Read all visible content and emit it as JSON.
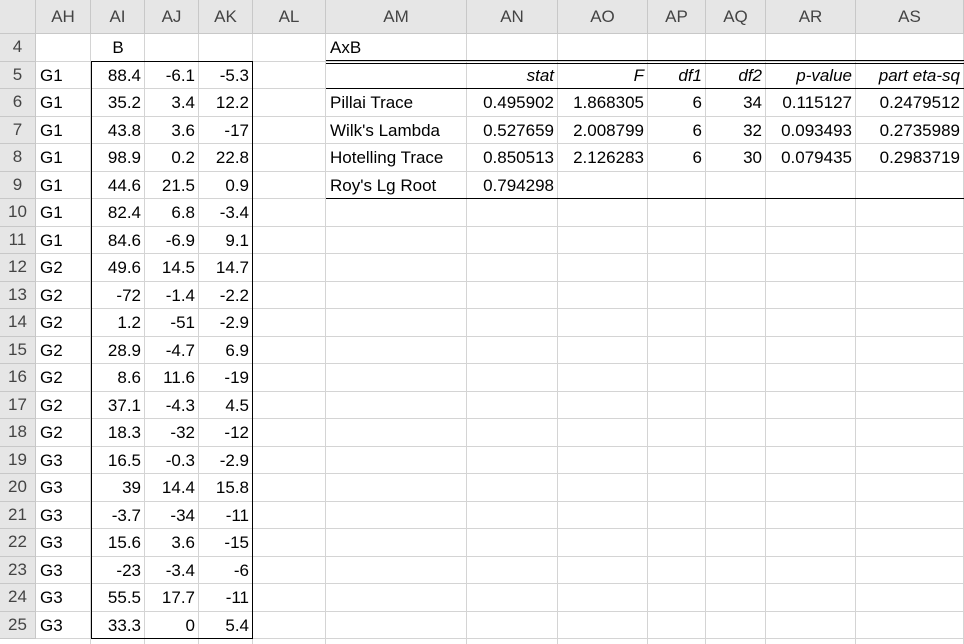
{
  "columns": [
    "AH",
    "AI",
    "AJ",
    "AK",
    "AL",
    "AM",
    "AN",
    "AO",
    "AP",
    "AQ",
    "AR",
    "AS"
  ],
  "rows": [
    "4",
    "5",
    "6",
    "7",
    "8",
    "9",
    "10",
    "11",
    "12",
    "13",
    "14",
    "15",
    "16",
    "17",
    "18",
    "19",
    "20",
    "21",
    "22",
    "23",
    "24",
    "25"
  ],
  "left_table": {
    "header": "B",
    "rows": [
      [
        "G1",
        "88.4",
        "-6.1",
        "-5.3"
      ],
      [
        "G1",
        "35.2",
        "3.4",
        "12.2"
      ],
      [
        "G1",
        "43.8",
        "3.6",
        "-17"
      ],
      [
        "G1",
        "98.9",
        "0.2",
        "22.8"
      ],
      [
        "G1",
        "44.6",
        "21.5",
        "0.9"
      ],
      [
        "G1",
        "82.4",
        "6.8",
        "-3.4"
      ],
      [
        "G1",
        "84.6",
        "-6.9",
        "9.1"
      ],
      [
        "G2",
        "49.6",
        "14.5",
        "14.7"
      ],
      [
        "G2",
        "-72",
        "-1.4",
        "-2.2"
      ],
      [
        "G2",
        "1.2",
        "-51",
        "-2.9"
      ],
      [
        "G2",
        "28.9",
        "-4.7",
        "6.9"
      ],
      [
        "G2",
        "8.6",
        "11.6",
        "-19"
      ],
      [
        "G2",
        "37.1",
        "-4.3",
        "4.5"
      ],
      [
        "G2",
        "18.3",
        "-32",
        "-12"
      ],
      [
        "G3",
        "16.5",
        "-0.3",
        "-2.9"
      ],
      [
        "G3",
        "39",
        "14.4",
        "15.8"
      ],
      [
        "G3",
        "-3.7",
        "-34",
        "-11"
      ],
      [
        "G3",
        "15.6",
        "3.6",
        "-15"
      ],
      [
        "G3",
        "-23",
        "-3.4",
        "-6"
      ],
      [
        "G3",
        "55.5",
        "17.7",
        "-11"
      ],
      [
        "G3",
        "33.3",
        "0",
        "5.4"
      ]
    ]
  },
  "manova": {
    "title": "AxB",
    "headers": [
      "stat",
      "F",
      "df1",
      "df2",
      "p-value",
      "part eta-sq"
    ],
    "rows": [
      {
        "label": "Pillai Trace",
        "values": [
          "0.495902",
          "1.868305",
          "6",
          "34",
          "0.115127",
          "0.2479512"
        ]
      },
      {
        "label": "Wilk's Lambda",
        "values": [
          "0.527659",
          "2.008799",
          "6",
          "32",
          "0.093493",
          "0.2735989"
        ]
      },
      {
        "label": "Hotelling Trace",
        "values": [
          "0.850513",
          "2.126283",
          "6",
          "30",
          "0.079435",
          "0.2983719"
        ]
      },
      {
        "label": "Roy's Lg Root",
        "values": [
          "0.794298",
          "",
          "",
          "",
          "",
          ""
        ]
      }
    ]
  }
}
